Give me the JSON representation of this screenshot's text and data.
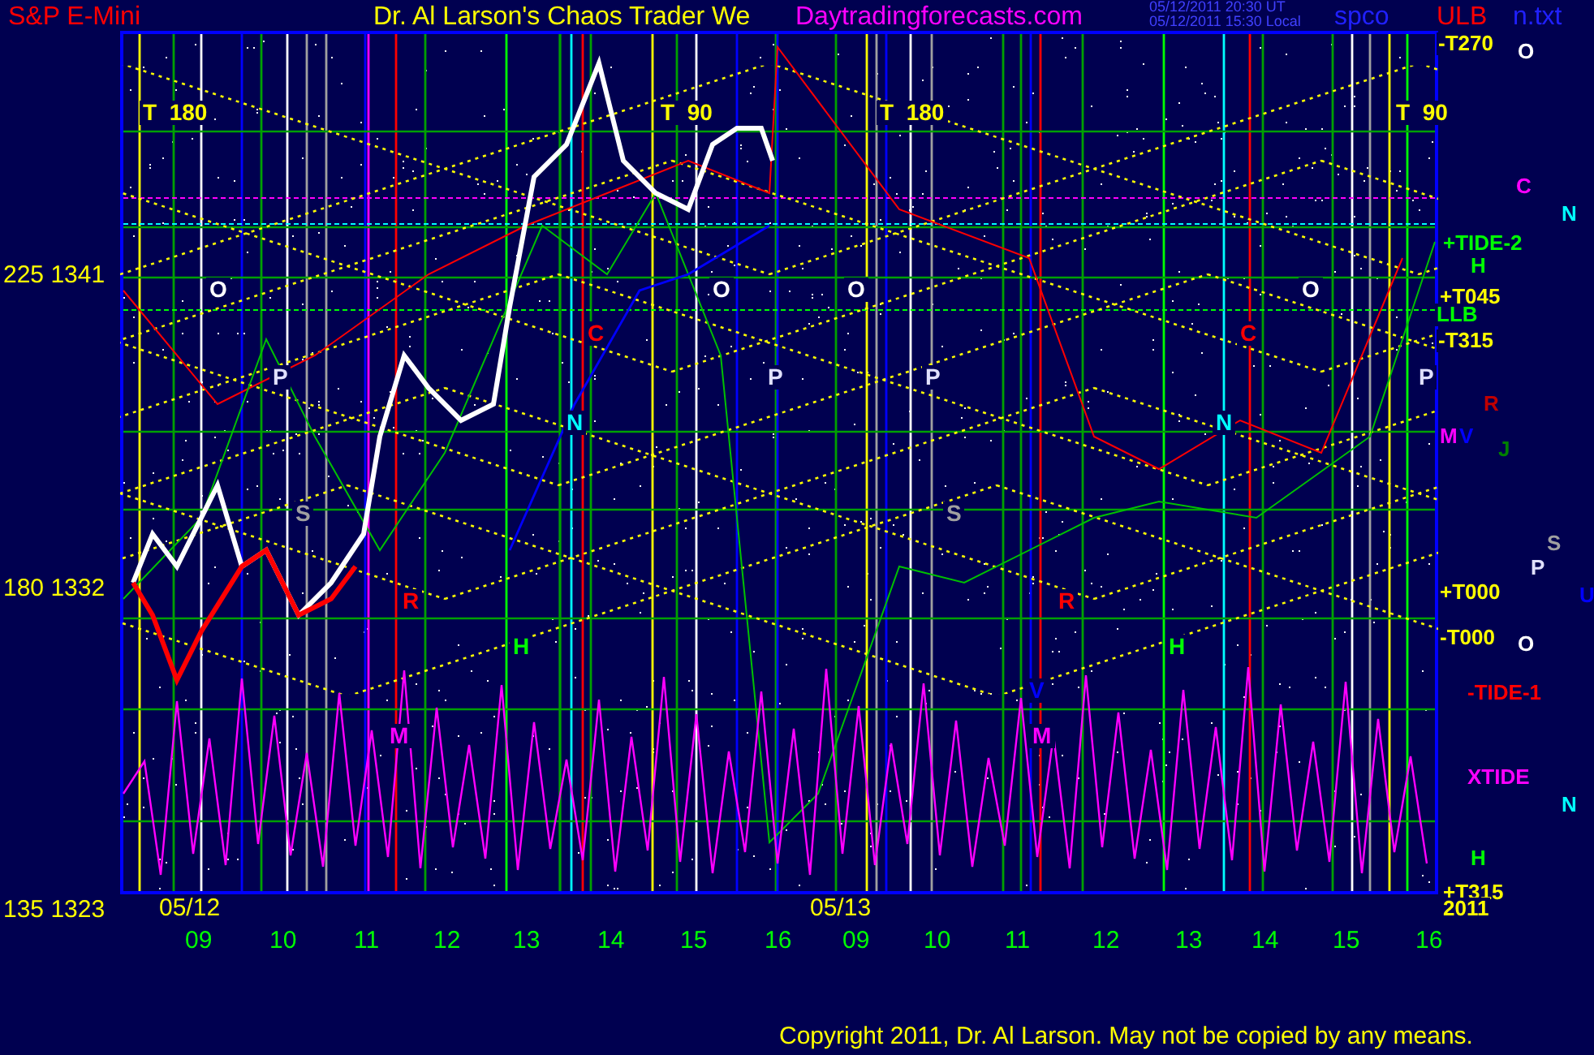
{
  "header": {
    "symbol": "S&P E-Mini",
    "title": "Dr. Al Larson's Chaos Trader We",
    "site": "Daytradingforecasts.com",
    "time_ut": "05/12/2011 20:30 UT",
    "time_local": "05/12/2011 15:30 Local",
    "file_start": "spco",
    "file_end": "n.txt",
    "flag": "ULB"
  },
  "price_labels": [
    "225 1341",
    "180 1332",
    "135 1323"
  ],
  "right_labels": [
    {
      "text": "-T270",
      "color": "#ffff00"
    },
    {
      "text": "+TIDE-2",
      "color": "#00ff00"
    },
    {
      "text": "+T045",
      "color": "#ffff00"
    },
    {
      "text": "LLB",
      "color": "#00ff00"
    },
    {
      "text": "-T315",
      "color": "#ffff00"
    },
    {
      "text": "+T000",
      "color": "#ffff00"
    },
    {
      "text": "-T000",
      "color": "#ffff00"
    },
    {
      "text": "-TIDE-1",
      "color": "#ff0000"
    },
    {
      "text": "XTIDE",
      "color": "#ff00ff"
    },
    {
      "text": "+T315",
      "color": "#ffff00"
    },
    {
      "text": "2011",
      "color": "#ffff00"
    }
  ],
  "side_marks": [
    {
      "text": "O",
      "color": "#ffffff"
    },
    {
      "text": "C",
      "color": "#ff00ff"
    },
    {
      "text": "N",
      "color": "#00ffff"
    },
    {
      "text": "H",
      "color": "#00ff00"
    },
    {
      "text": "R",
      "color": "#c00000"
    },
    {
      "text": "M",
      "color": "#ff00ff"
    },
    {
      "text": "V",
      "color": "#0000ff"
    },
    {
      "text": "J",
      "color": "#008000"
    },
    {
      "text": "S",
      "color": "#a0a0a0"
    },
    {
      "text": "P",
      "color": "#e0e0ff"
    },
    {
      "text": "U",
      "color": "#0000ff"
    },
    {
      "text": "O",
      "color": "#ffffff"
    },
    {
      "text": "N",
      "color": "#00ffff"
    },
    {
      "text": "H",
      "color": "#00ff00"
    }
  ],
  "chart_marks": [
    {
      "text": "T  180",
      "color": "#ffff00"
    },
    {
      "text": "T  90",
      "color": "#ffff00"
    },
    {
      "text": "T  180",
      "color": "#ffff00"
    },
    {
      "text": "T  90",
      "color": "#ffff00"
    },
    {
      "text": "O",
      "color": "#ffffff"
    },
    {
      "text": "O",
      "color": "#ffffff"
    },
    {
      "text": "O",
      "color": "#ffffff"
    },
    {
      "text": "O",
      "color": "#ffffff"
    },
    {
      "text": "P",
      "color": "#e0e0ff"
    },
    {
      "text": "P",
      "color": "#e0e0ff"
    },
    {
      "text": "P",
      "color": "#e0e0ff"
    },
    {
      "text": "P",
      "color": "#e0e0ff"
    },
    {
      "text": "C",
      "color": "#ff0000"
    },
    {
      "text": "C",
      "color": "#ff0000"
    },
    {
      "text": "N",
      "color": "#00ffff"
    },
    {
      "text": "N",
      "color": "#00ffff"
    },
    {
      "text": "S",
      "color": "#a0a0a0"
    },
    {
      "text": "S",
      "color": "#a0a0a0"
    },
    {
      "text": "R",
      "color": "#ff0000"
    },
    {
      "text": "R",
      "color": "#ff0000"
    },
    {
      "text": "H",
      "color": "#00ff00"
    },
    {
      "text": "H",
      "color": "#00ff00"
    },
    {
      "text": "M",
      "color": "#ff00ff"
    },
    {
      "text": "M",
      "color": "#ff00ff"
    },
    {
      "text": "V",
      "color": "#0000ff"
    }
  ],
  "date_labels": [
    "05/12",
    "05/13"
  ],
  "hour_labels": [
    "09",
    "10",
    "11",
    "12",
    "13",
    "14",
    "15",
    "16",
    "09",
    "10",
    "11",
    "12",
    "13",
    "14",
    "15",
    "16"
  ],
  "copyright": "Copyright 2011, Dr. Al Larson. May not be copied by any means."
}
